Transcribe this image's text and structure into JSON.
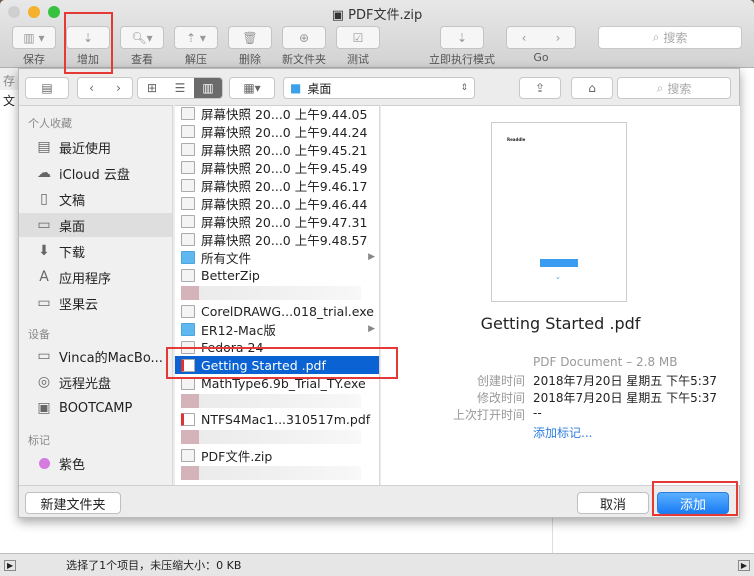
{
  "window": {
    "title": "PDF文件.zip"
  },
  "toolbar": {
    "items": [
      "保存",
      "增加",
      "查看",
      "解压",
      "删除",
      "新文件夹",
      "测试",
      "立即执行模式",
      "Go"
    ],
    "search_placeholder": "搜索"
  },
  "behind": {
    "col_chars": [
      "存",
      "文"
    ]
  },
  "status_bar": {
    "text": "选择了1个项目，未压缩大小：0 KB"
  },
  "sheet": {
    "location": "桌面",
    "search_placeholder": "搜索",
    "sidebar": {
      "favorites_header": "个人收藏",
      "favorites": [
        "最近使用",
        "iCloud 云盘",
        "文稿",
        "桌面",
        "下载",
        "应用程序",
        "坚果云"
      ],
      "devices_header": "设备",
      "devices": [
        "Vinca的MacBo...",
        "远程光盘",
        "BOOTCAMP"
      ],
      "tags_header": "标记",
      "tags": [
        "紫色"
      ],
      "tag_color": "#d47ae0"
    },
    "files": [
      "屏幕快照 20...0 上午9.44.05",
      "屏幕快照 20...0 上午9.44.24",
      "屏幕快照 20...0 上午9.45.21",
      "屏幕快照 20...0 上午9.45.49",
      "屏幕快照 20...0 上午9.46.17",
      "屏幕快照 20...0 上午9.46.44",
      "屏幕快照 20...0 上午9.47.31",
      "屏幕快照 20...0 上午9.48.57",
      "所有文件",
      "BetterZip",
      "",
      "CorelDRAWG...018_trial.exe",
      "ER12-Mac版",
      "Fedora 24",
      "Getting Started .pdf",
      "MathType6.9b_Trial_TY.exe",
      "",
      "NTFS4Mac1...310517m.pdf",
      "",
      "PDF文件.zip",
      ""
    ],
    "preview": {
      "name": "Getting Started .pdf",
      "kind": "PDF Document – 2.8 MB",
      "created_label": "创建时间",
      "created": "2018年7月20日 星期五 下午5:37",
      "modified_label": "修改时间",
      "modified": "2018年7月20日 星期五 下午5:37",
      "opened_label": "上次打开时间",
      "opened": "--",
      "add_tag": "添加标记...",
      "thumb_text": "Readdle"
    },
    "new_folder": "新建文件夹",
    "cancel": "取消",
    "add": "添加"
  }
}
